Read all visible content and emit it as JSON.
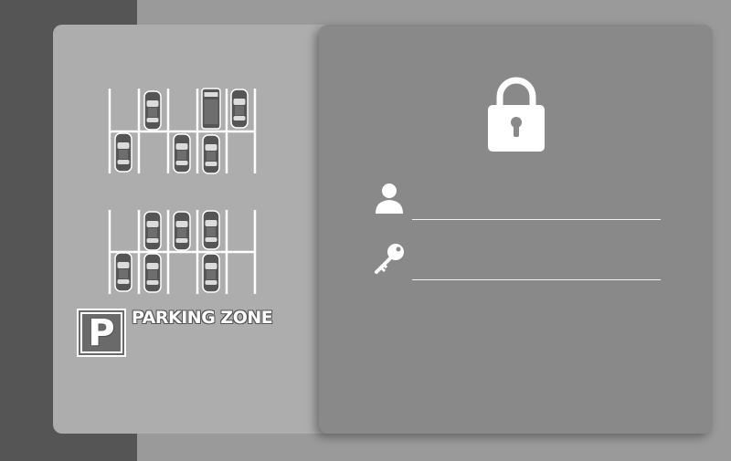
{
  "brand": {
    "logo_letter": "P",
    "logo_text": "PARKING ZONE",
    "illustration": "parking-lot-top-view"
  },
  "login": {
    "lock_icon": "padlock-icon",
    "username": {
      "icon": "user-icon",
      "value": "",
      "placeholder": ""
    },
    "password": {
      "icon": "key-icon",
      "value": "",
      "placeholder": ""
    }
  },
  "colors": {
    "page_background": "#9a9a9a",
    "left_strip": "#555555",
    "brand_panel": "#adadad",
    "login_panel": "#898989",
    "accent": "#ffffff"
  }
}
